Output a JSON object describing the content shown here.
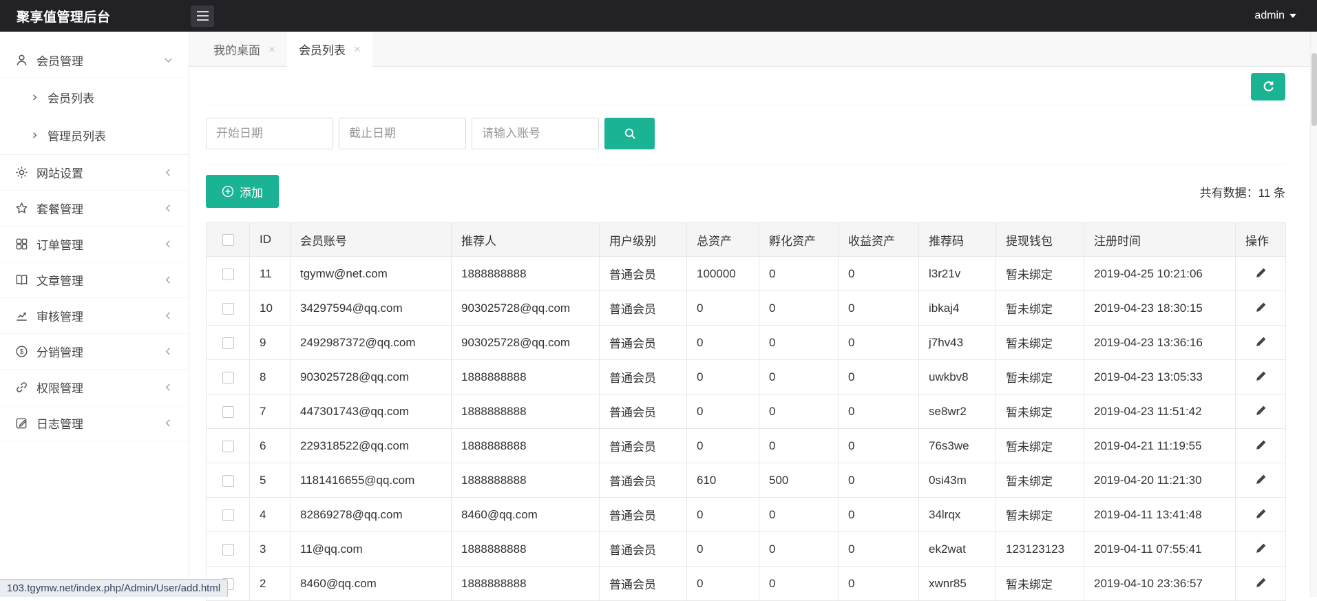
{
  "colors": {
    "accent": "#1ab394",
    "topbar_bg": "#222226"
  },
  "topbar": {
    "title": "聚享值管理后台",
    "user": "admin"
  },
  "icons": {
    "close": "×"
  },
  "sidebar": {
    "groups": [
      {
        "label": "会员管理",
        "icon": "user-icon",
        "state": "expanded",
        "children": [
          {
            "label": "会员列表"
          },
          {
            "label": "管理员列表"
          }
        ]
      },
      {
        "label": "网站设置",
        "icon": "gear-icon",
        "state": "collapsed"
      },
      {
        "label": "套餐管理",
        "icon": "star-icon",
        "state": "collapsed"
      },
      {
        "label": "订单管理",
        "icon": "grid-icon",
        "state": "collapsed"
      },
      {
        "label": "文章管理",
        "icon": "book-icon",
        "state": "collapsed"
      },
      {
        "label": "审核管理",
        "icon": "chart-icon",
        "state": "collapsed"
      },
      {
        "label": "分销管理",
        "icon": "dollar-icon",
        "state": "collapsed"
      },
      {
        "label": "权限管理",
        "icon": "link-icon",
        "state": "collapsed"
      },
      {
        "label": "日志管理",
        "icon": "edit-icon",
        "state": "collapsed"
      }
    ]
  },
  "tabs": {
    "items": [
      {
        "label": "我的桌面",
        "active": false
      },
      {
        "label": "会员列表",
        "active": true
      }
    ]
  },
  "search": {
    "start_placeholder": "开始日期",
    "end_placeholder": "截止日期",
    "account_placeholder": "请输入账号"
  },
  "toolbar": {
    "add_label": "添加",
    "count_text": "共有数据：11 条"
  },
  "table": {
    "headers": [
      "ID",
      "会员账号",
      "推荐人",
      "用户级别",
      "总资产",
      "孵化资产",
      "收益资产",
      "推荐码",
      "提现钱包",
      "注册时间",
      "操作"
    ],
    "rows": [
      {
        "id": "11",
        "account": "tgymw@net.com",
        "referrer": "1888888888",
        "level": "普通会员",
        "total": "100000",
        "hatch": "0",
        "income": "0",
        "code": "l3r21v",
        "wallet": "暂未绑定",
        "time": "2019-04-25 10:21:06"
      },
      {
        "id": "10",
        "account": "34297594@qq.com",
        "referrer": "903025728@qq.com",
        "level": "普通会员",
        "total": "0",
        "hatch": "0",
        "income": "0",
        "code": "ibkaj4",
        "wallet": "暂未绑定",
        "time": "2019-04-23 18:30:15"
      },
      {
        "id": "9",
        "account": "2492987372@qq.com",
        "referrer": "903025728@qq.com",
        "level": "普通会员",
        "total": "0",
        "hatch": "0",
        "income": "0",
        "code": "j7hv43",
        "wallet": "暂未绑定",
        "time": "2019-04-23 13:36:16"
      },
      {
        "id": "8",
        "account": "903025728@qq.com",
        "referrer": "1888888888",
        "level": "普通会员",
        "total": "0",
        "hatch": "0",
        "income": "0",
        "code": "uwkbv8",
        "wallet": "暂未绑定",
        "time": "2019-04-23 13:05:33"
      },
      {
        "id": "7",
        "account": "447301743@qq.com",
        "referrer": "1888888888",
        "level": "普通会员",
        "total": "0",
        "hatch": "0",
        "income": "0",
        "code": "se8wr2",
        "wallet": "暂未绑定",
        "time": "2019-04-23 11:51:42"
      },
      {
        "id": "6",
        "account": "229318522@qq.com",
        "referrer": "1888888888",
        "level": "普通会员",
        "total": "0",
        "hatch": "0",
        "income": "0",
        "code": "76s3we",
        "wallet": "暂未绑定",
        "time": "2019-04-21 11:19:55"
      },
      {
        "id": "5",
        "account": "1181416655@qq.com",
        "referrer": "1888888888",
        "level": "普通会员",
        "total": "610",
        "hatch": "500",
        "income": "0",
        "code": "0si43m",
        "wallet": "暂未绑定",
        "time": "2019-04-20 11:21:30"
      },
      {
        "id": "4",
        "account": "82869278@qq.com",
        "referrer": "8460@qq.com",
        "level": "普通会员",
        "total": "0",
        "hatch": "0",
        "income": "0",
        "code": "34lrqx",
        "wallet": "暂未绑定",
        "time": "2019-04-11 13:41:48"
      },
      {
        "id": "3",
        "account": "11@qq.com",
        "referrer": "1888888888",
        "level": "普通会员",
        "total": "0",
        "hatch": "0",
        "income": "0",
        "code": "ek2wat",
        "wallet": "123123123",
        "time": "2019-04-11 07:55:41"
      },
      {
        "id": "2",
        "account": "8460@qq.com",
        "referrer": "1888888888",
        "level": "普通会员",
        "total": "0",
        "hatch": "0",
        "income": "0",
        "code": "xwnr85",
        "wallet": "暂未绑定",
        "time": "2019-04-10 23:36:57"
      }
    ]
  },
  "statusbar": {
    "url": "103.tgymw.net/index.php/Admin/User/add.html"
  }
}
